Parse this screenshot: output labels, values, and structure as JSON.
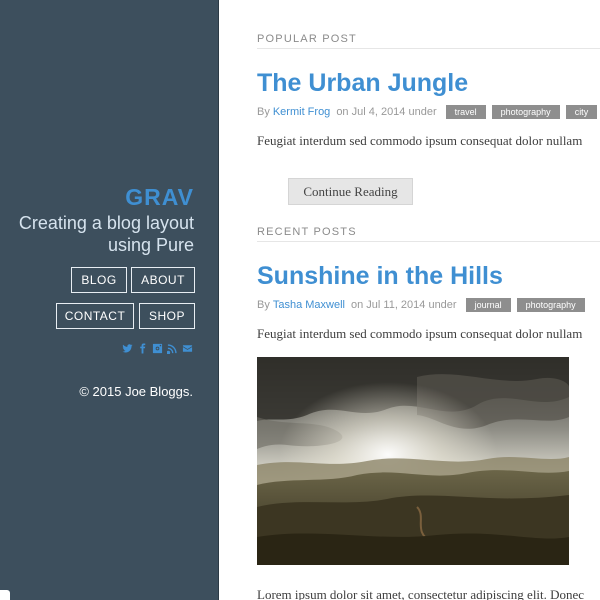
{
  "sidebar": {
    "brand_title": "GRAV",
    "tagline": "Creating a blog layout using Pure",
    "nav": [
      "BLOG",
      "ABOUT",
      "CONTACT",
      "SHOP"
    ],
    "social_icons": [
      "twitter-icon",
      "facebook-icon",
      "instagram-icon",
      "rss-icon",
      "email-icon"
    ],
    "copyright": "© 2015 Joe Bloggs."
  },
  "colors": {
    "sidebar_bg": "#3d4f5d",
    "accent": "#3f8fd2",
    "tag_bg": "#8e8e8e",
    "button_bg": "#e6e6e6"
  },
  "popular": {
    "section_title": "POPULAR POST",
    "title": "The Urban Jungle",
    "by": "By",
    "author": "Kermit Frog",
    "date": "on Jul 4, 2014 under",
    "tags": [
      "travel",
      "photography",
      "city"
    ],
    "excerpt": "Feugiat interdum sed commodo ipsum consequat dolor nullam",
    "continue_label": "Continue Reading"
  },
  "recent": {
    "section_title": "RECENT POSTS",
    "title": "Sunshine in the Hills",
    "by": "By",
    "author": "Tasha Maxwell",
    "date": "on Jul 11, 2014 under",
    "tags": [
      "journal",
      "photography"
    ],
    "excerpt": "Feugiat interdum sed commodo ipsum consequat dolor nullam",
    "body": "Lorem ipsum dolor sit amet, consectetur adipiscing elit. Donec"
  }
}
